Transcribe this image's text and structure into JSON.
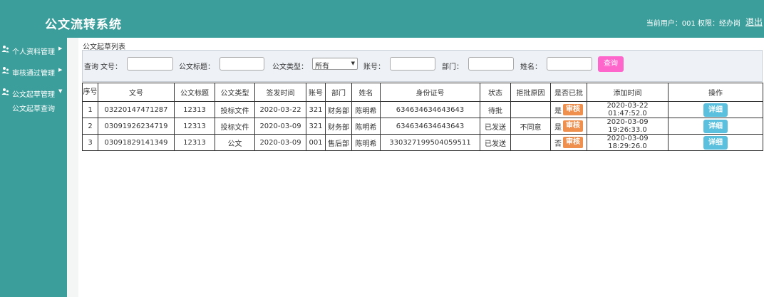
{
  "header": {
    "title": "公文流转系统",
    "user_info": "当前用户：001  权限：经办岗",
    "logout_label": "退出"
  },
  "sidebar": {
    "items": [
      {
        "label": "个人资料管理",
        "icon": "user-group-icon",
        "arrow": "▶"
      },
      {
        "label": "审核通过管理",
        "icon": "user-group-icon",
        "arrow": "▶"
      },
      {
        "label": "公文起草管理",
        "icon": "user-group-icon",
        "arrow": "▼"
      }
    ],
    "sub_item": "公文起草查询"
  },
  "breadcrumb": "公文起草列表",
  "search": {
    "query_label": "查询",
    "doc_no_label": "文号：",
    "doc_title_label": "公文标题：",
    "doc_type_label": "公文类型：",
    "doc_type_value": "所有",
    "account_label": "账号：",
    "dept_label": "部门：",
    "name_label": "姓名：",
    "button_label": "查询"
  },
  "table": {
    "headers": {
      "seq": "序号",
      "doc_no": "文号",
      "title": "公文标题",
      "type": "公文类型",
      "issue_date": "签发时间",
      "account": "账号",
      "dept": "部门",
      "name": "姓名",
      "id_no": "身份证号",
      "status": "状态",
      "reject_reason": "拒批原因",
      "approved": "是否已批",
      "added_time": "添加时间",
      "action": "操作"
    },
    "review_label": "审核",
    "detail_label": "详细",
    "rows": [
      {
        "seq": "1",
        "doc_no": "03220147471287",
        "title": "12313",
        "type": "投标文件",
        "issue_date": "2020-03-22",
        "account": "321",
        "dept": "财务部",
        "name": "陈明希",
        "id_no": "634634634643643",
        "status": "待批",
        "reject_reason": "",
        "approved": "是",
        "added_time": "2020-03-22 01:47:52.0"
      },
      {
        "seq": "2",
        "doc_no": "03091926234719",
        "title": "12313",
        "type": "投标文件",
        "issue_date": "2020-03-09",
        "account": "321",
        "dept": "财务部",
        "name": "陈明希",
        "id_no": "634634634643643",
        "status": "已发送",
        "reject_reason": "不同意",
        "approved": "是",
        "added_time": "2020-03-09 19:26:33.0"
      },
      {
        "seq": "3",
        "doc_no": "03091829141349",
        "title": "12313",
        "type": "公文",
        "issue_date": "2020-03-09",
        "account": "001",
        "dept": "售后部",
        "name": "陈明希",
        "id_no": "330327199504059511",
        "status": "已发送",
        "reject_reason": "",
        "approved": "否",
        "added_time": "2020-03-09 18:29:26.0"
      }
    ]
  }
}
